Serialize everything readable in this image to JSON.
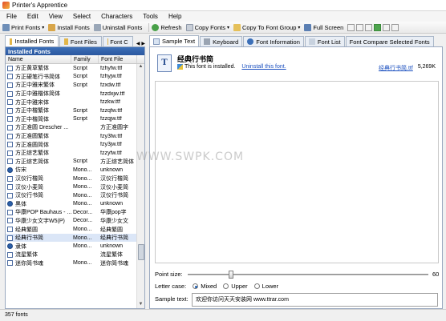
{
  "window": {
    "title": "Printer's Apprentice"
  },
  "menu": [
    "File",
    "Edit",
    "View",
    "Select",
    "Characters",
    "Tools",
    "Help"
  ],
  "toolbar": {
    "print_fonts": "Print Fonts",
    "install_fonts": "Install Fonts",
    "uninstall_fonts": "Uninstall Fonts",
    "refresh": "Refresh",
    "copy_fonts": "Copy Fonts",
    "copy_to_font_group": "Copy To Font Group",
    "full_screen": "Full Screen"
  },
  "left_tabs": [
    "Installed Fonts",
    "Font Files",
    "Font C"
  ],
  "left_panel": {
    "header": "Installed Fonts",
    "columns": [
      "Name",
      "Family",
      "Font File"
    ],
    "rows": [
      {
        "name": "方正黄草繁体",
        "family": "Script",
        "file": "fzhyfw.ttf"
      },
      {
        "name": "方正硬笔行书简体",
        "family": "Script",
        "file": "fzhyjw.ttf"
      },
      {
        "name": "方正中雅宋繁体",
        "family": "Script",
        "file": "fzxdw.ttf"
      },
      {
        "name": "方正中雅楷体简体",
        "family": "",
        "file": "fzzdxjw.ttf"
      },
      {
        "name": "方正中雅宋体",
        "family": "",
        "file": "fzzkw.ttf"
      },
      {
        "name": "方正中楷繁体",
        "family": "Script",
        "file": "fzzqfw.ttf"
      },
      {
        "name": "方正中楷简体",
        "family": "Script",
        "file": "fzzqjw.ttf"
      },
      {
        "name": "方正准圆 Drescher ...",
        "family": "",
        "file": "方正准圆字"
      },
      {
        "name": "方正准圆繁体",
        "family": "",
        "file": "fzy3fw.ttf"
      },
      {
        "name": "方正准圆简体",
        "family": "",
        "file": "fzy3jw.ttf"
      },
      {
        "name": "方正综艺繁体",
        "family": "",
        "file": "fzzyfw.ttf"
      },
      {
        "name": "方正综艺简体",
        "family": "Script",
        "file": "方正综艺简体"
      },
      {
        "name": "仿宋",
        "family": "Mono...",
        "file": "unknown"
      },
      {
        "name": "汉仪行楷简",
        "family": "Mono...",
        "file": "汉仪行楷简"
      },
      {
        "name": "汉仪小麦简",
        "family": "Mono...",
        "file": "汉仪小麦简"
      },
      {
        "name": "汉仪行书简",
        "family": "Mono...",
        "file": "汉仪行书简"
      },
      {
        "name": "黑体",
        "family": "Mono...",
        "file": "unknown"
      },
      {
        "name": "华康POP Bauhaus - ...",
        "family": "Decor...",
        "file": "华康pop字"
      },
      {
        "name": "华康少女文字W5(P)",
        "family": "Decor...",
        "file": "华康少女文"
      },
      {
        "name": "经典繁圆",
        "family": "Mono...",
        "file": "经典繁圆"
      },
      {
        "name": "经典行书简",
        "family": "Mono...",
        "file": "经典行书简"
      },
      {
        "name": "隶体",
        "family": "Mono...",
        "file": "unknown"
      },
      {
        "name": "流星繁体",
        "family": "",
        "file": "流星繁体"
      },
      {
        "name": "迷你简书魂",
        "family": "Mono...",
        "file": "迷你简书魂"
      }
    ],
    "selected_index": 20
  },
  "right_tabs": [
    "Sample Text",
    "Keyboard",
    "Font Information",
    "Font List",
    "Font Compare Selected Fonts"
  ],
  "right_panel": {
    "font_name": "经典行书简",
    "installed_text": "This font is installed.",
    "uninstall_link": "Uninstall this font.",
    "file_link": "经典行书简.ttf",
    "file_size": "5,269K",
    "point_size_label": "Point size:",
    "point_size_value": "60",
    "point_size_fraction": 0.18,
    "letter_case_label": "Letter case:",
    "letter_case_options": [
      "Mixed",
      "Upper",
      "Lower"
    ],
    "letter_case_selected": "Mixed",
    "sample_text_label": "Sample text:",
    "sample_text_value": "欢迎你访问天天安装网 www.ttrar.com"
  },
  "status": {
    "count": "357 fonts"
  },
  "watermark": "WWW.SWPK.COM",
  "colors": {
    "accent": "#2b58a0",
    "selection": "#dbe6f7",
    "link": "#1a4fbf"
  }
}
